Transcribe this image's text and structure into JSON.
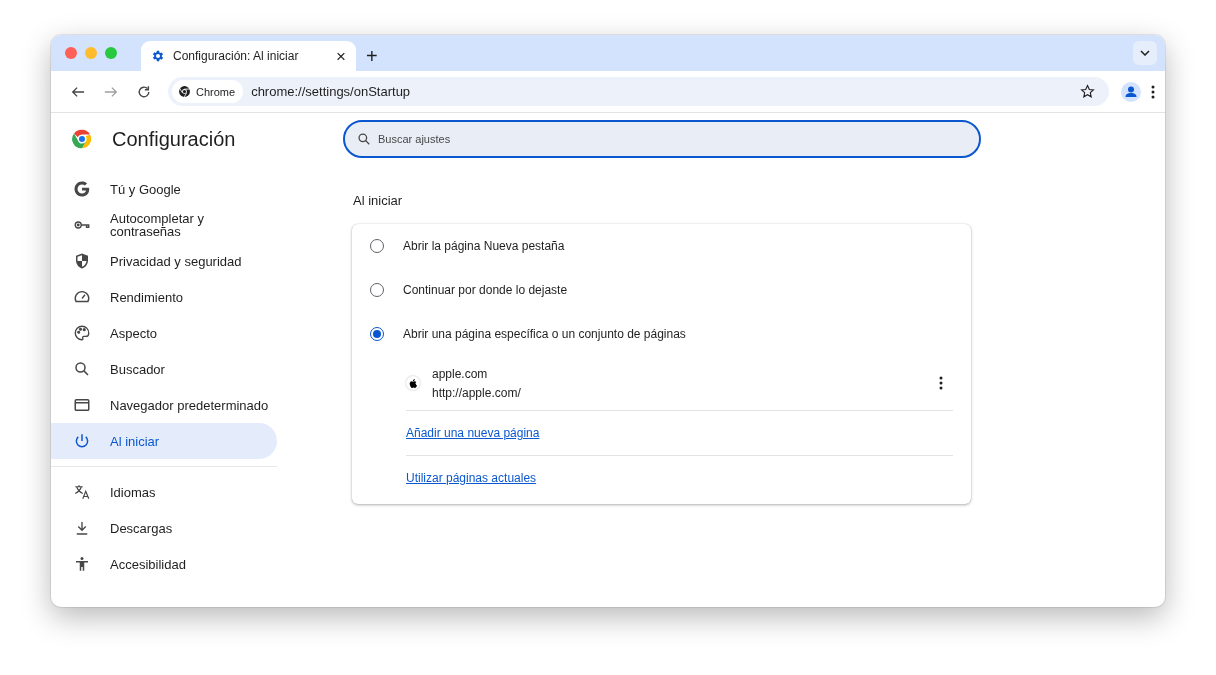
{
  "tab": {
    "title": "Configuración: Al iniciar",
    "close": "×",
    "new_tab": "+"
  },
  "toolbar": {
    "chip": "Chrome",
    "url": "chrome://settings/onStartup"
  },
  "header": {
    "title": "Configuración",
    "search_placeholder": "Buscar ajustes"
  },
  "sidebar": {
    "sections": [
      {
        "items": [
          {
            "label": "Tú y Google",
            "selected": false
          },
          {
            "label": "Autocompletar y contraseñas",
            "selected": false
          },
          {
            "label": "Privacidad y seguridad",
            "selected": false
          },
          {
            "label": "Rendimiento",
            "selected": false
          },
          {
            "label": "Aspecto",
            "selected": false
          },
          {
            "label": "Buscador",
            "selected": false
          },
          {
            "label": "Navegador predeterminado",
            "selected": false
          },
          {
            "label": "Al iniciar",
            "selected": true
          }
        ]
      },
      {
        "items": [
          {
            "label": "Idiomas",
            "selected": false
          },
          {
            "label": "Descargas",
            "selected": false
          },
          {
            "label": "Accesibilidad",
            "selected": false
          }
        ]
      }
    ]
  },
  "section_title": "Al iniciar",
  "options": [
    {
      "label": "Abrir la página Nueva pestaña",
      "selected": false
    },
    {
      "label": "Continuar por donde lo dejaste",
      "selected": false
    },
    {
      "label": "Abrir una página específica o un conjunto de páginas",
      "selected": true
    }
  ],
  "pages": [
    {
      "name": "apple.com",
      "url": "http://apple.com/"
    }
  ],
  "links": [
    "Añadir una nueva página",
    "Utilizar páginas actuales"
  ]
}
